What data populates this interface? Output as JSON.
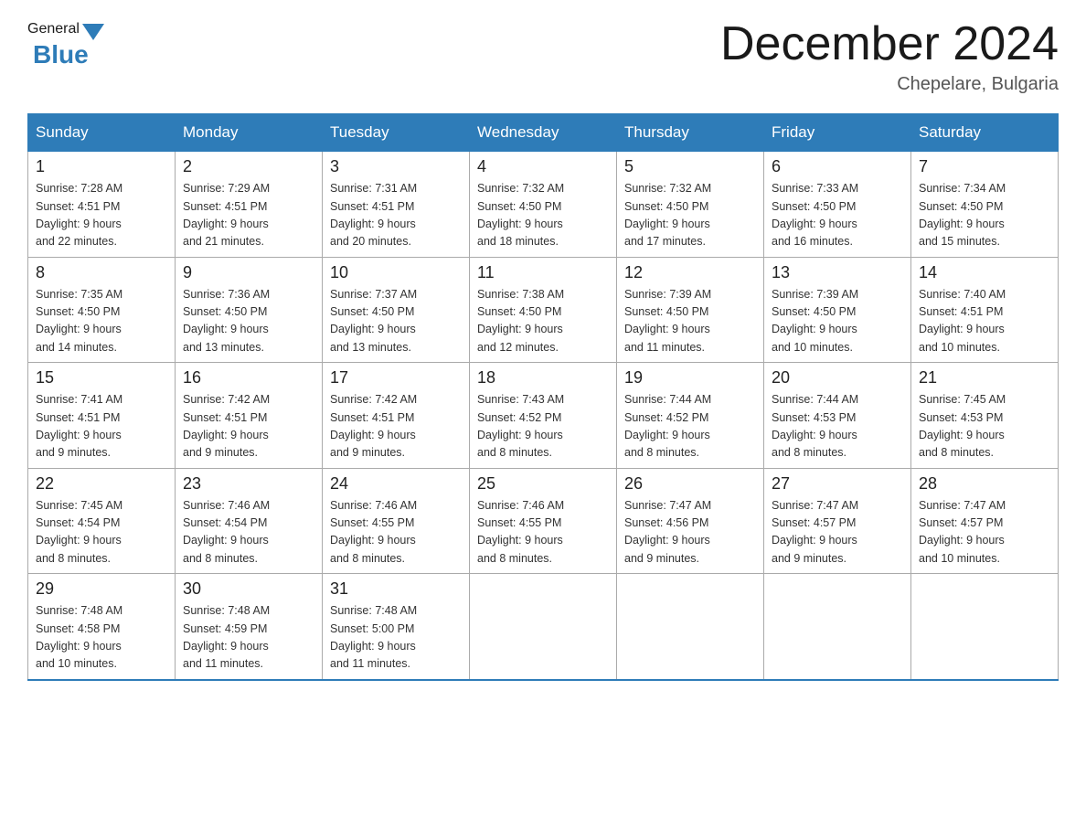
{
  "header": {
    "logo": {
      "general": "General",
      "blue": "Blue"
    },
    "month_title": "December 2024",
    "location": "Chepelare, Bulgaria"
  },
  "days_of_week": [
    "Sunday",
    "Monday",
    "Tuesday",
    "Wednesday",
    "Thursday",
    "Friday",
    "Saturday"
  ],
  "weeks": [
    [
      {
        "day": "1",
        "sunrise": "7:28 AM",
        "sunset": "4:51 PM",
        "daylight": "9 hours and 22 minutes."
      },
      {
        "day": "2",
        "sunrise": "7:29 AM",
        "sunset": "4:51 PM",
        "daylight": "9 hours and 21 minutes."
      },
      {
        "day": "3",
        "sunrise": "7:31 AM",
        "sunset": "4:51 PM",
        "daylight": "9 hours and 20 minutes."
      },
      {
        "day": "4",
        "sunrise": "7:32 AM",
        "sunset": "4:50 PM",
        "daylight": "9 hours and 18 minutes."
      },
      {
        "day": "5",
        "sunrise": "7:32 AM",
        "sunset": "4:50 PM",
        "daylight": "9 hours and 17 minutes."
      },
      {
        "day": "6",
        "sunrise": "7:33 AM",
        "sunset": "4:50 PM",
        "daylight": "9 hours and 16 minutes."
      },
      {
        "day": "7",
        "sunrise": "7:34 AM",
        "sunset": "4:50 PM",
        "daylight": "9 hours and 15 minutes."
      }
    ],
    [
      {
        "day": "8",
        "sunrise": "7:35 AM",
        "sunset": "4:50 PM",
        "daylight": "9 hours and 14 minutes."
      },
      {
        "day": "9",
        "sunrise": "7:36 AM",
        "sunset": "4:50 PM",
        "daylight": "9 hours and 13 minutes."
      },
      {
        "day": "10",
        "sunrise": "7:37 AM",
        "sunset": "4:50 PM",
        "daylight": "9 hours and 13 minutes."
      },
      {
        "day": "11",
        "sunrise": "7:38 AM",
        "sunset": "4:50 PM",
        "daylight": "9 hours and 12 minutes."
      },
      {
        "day": "12",
        "sunrise": "7:39 AM",
        "sunset": "4:50 PM",
        "daylight": "9 hours and 11 minutes."
      },
      {
        "day": "13",
        "sunrise": "7:39 AM",
        "sunset": "4:50 PM",
        "daylight": "9 hours and 10 minutes."
      },
      {
        "day": "14",
        "sunrise": "7:40 AM",
        "sunset": "4:51 PM",
        "daylight": "9 hours and 10 minutes."
      }
    ],
    [
      {
        "day": "15",
        "sunrise": "7:41 AM",
        "sunset": "4:51 PM",
        "daylight": "9 hours and 9 minutes."
      },
      {
        "day": "16",
        "sunrise": "7:42 AM",
        "sunset": "4:51 PM",
        "daylight": "9 hours and 9 minutes."
      },
      {
        "day": "17",
        "sunrise": "7:42 AM",
        "sunset": "4:51 PM",
        "daylight": "9 hours and 9 minutes."
      },
      {
        "day": "18",
        "sunrise": "7:43 AM",
        "sunset": "4:52 PM",
        "daylight": "9 hours and 8 minutes."
      },
      {
        "day": "19",
        "sunrise": "7:44 AM",
        "sunset": "4:52 PM",
        "daylight": "9 hours and 8 minutes."
      },
      {
        "day": "20",
        "sunrise": "7:44 AM",
        "sunset": "4:53 PM",
        "daylight": "9 hours and 8 minutes."
      },
      {
        "day": "21",
        "sunrise": "7:45 AM",
        "sunset": "4:53 PM",
        "daylight": "9 hours and 8 minutes."
      }
    ],
    [
      {
        "day": "22",
        "sunrise": "7:45 AM",
        "sunset": "4:54 PM",
        "daylight": "9 hours and 8 minutes."
      },
      {
        "day": "23",
        "sunrise": "7:46 AM",
        "sunset": "4:54 PM",
        "daylight": "9 hours and 8 minutes."
      },
      {
        "day": "24",
        "sunrise": "7:46 AM",
        "sunset": "4:55 PM",
        "daylight": "9 hours and 8 minutes."
      },
      {
        "day": "25",
        "sunrise": "7:46 AM",
        "sunset": "4:55 PM",
        "daylight": "9 hours and 8 minutes."
      },
      {
        "day": "26",
        "sunrise": "7:47 AM",
        "sunset": "4:56 PM",
        "daylight": "9 hours and 9 minutes."
      },
      {
        "day": "27",
        "sunrise": "7:47 AM",
        "sunset": "4:57 PM",
        "daylight": "9 hours and 9 minutes."
      },
      {
        "day": "28",
        "sunrise": "7:47 AM",
        "sunset": "4:57 PM",
        "daylight": "9 hours and 10 minutes."
      }
    ],
    [
      {
        "day": "29",
        "sunrise": "7:48 AM",
        "sunset": "4:58 PM",
        "daylight": "9 hours and 10 minutes."
      },
      {
        "day": "30",
        "sunrise": "7:48 AM",
        "sunset": "4:59 PM",
        "daylight": "9 hours and 11 minutes."
      },
      {
        "day": "31",
        "sunrise": "7:48 AM",
        "sunset": "5:00 PM",
        "daylight": "9 hours and 11 minutes."
      },
      null,
      null,
      null,
      null
    ]
  ],
  "labels": {
    "sunrise": "Sunrise:",
    "sunset": "Sunset:",
    "daylight": "Daylight:"
  }
}
